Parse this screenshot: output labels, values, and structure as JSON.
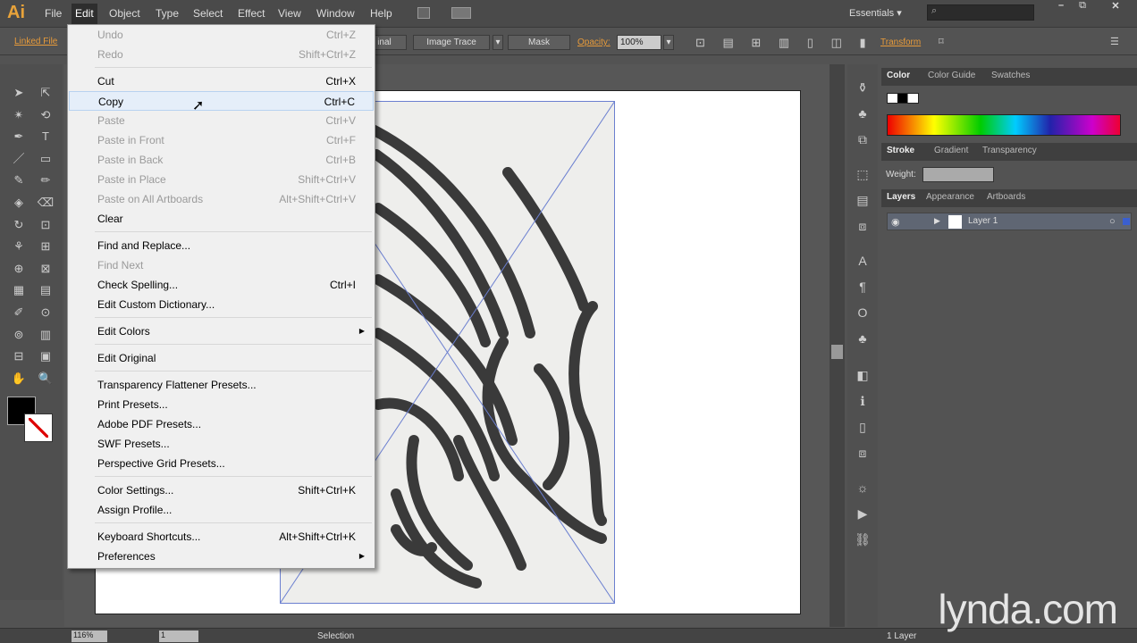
{
  "app": {
    "logo": "Ai"
  },
  "menubar": [
    "File",
    "Edit",
    "Object",
    "Type",
    "Select",
    "Effect",
    "View",
    "Window",
    "Help"
  ],
  "workspace": "Essentials",
  "control": {
    "linked_file": "Linked File",
    "embed_partial": "inal",
    "image_trace": "Image Trace",
    "mask": "Mask",
    "opacity_label": "Opacity:",
    "opacity_value": "100%",
    "transform": "Transform"
  },
  "edit_menu": [
    {
      "label": "Undo",
      "shortcut": "Ctrl+Z",
      "disabled": true
    },
    {
      "label": "Redo",
      "shortcut": "Shift+Ctrl+Z",
      "disabled": true
    },
    {
      "sep": true
    },
    {
      "label": "Cut",
      "shortcut": "Ctrl+X"
    },
    {
      "label": "Copy",
      "shortcut": "Ctrl+C",
      "highlight": true
    },
    {
      "label": "Paste",
      "shortcut": "Ctrl+V",
      "disabled": true
    },
    {
      "label": "Paste in Front",
      "shortcut": "Ctrl+F",
      "disabled": true
    },
    {
      "label": "Paste in Back",
      "shortcut": "Ctrl+B",
      "disabled": true
    },
    {
      "label": "Paste in Place",
      "shortcut": "Shift+Ctrl+V",
      "disabled": true
    },
    {
      "label": "Paste on All Artboards",
      "shortcut": "Alt+Shift+Ctrl+V",
      "disabled": true
    },
    {
      "label": "Clear",
      "shortcut": ""
    },
    {
      "sep": true
    },
    {
      "label": "Find and Replace...",
      "shortcut": ""
    },
    {
      "label": "Find Next",
      "shortcut": "",
      "disabled": true
    },
    {
      "label": "Check Spelling...",
      "shortcut": "Ctrl+I"
    },
    {
      "label": "Edit Custom Dictionary...",
      "shortcut": ""
    },
    {
      "sep": true
    },
    {
      "label": "Edit Colors",
      "shortcut": "",
      "submenu": true
    },
    {
      "sep": true
    },
    {
      "label": "Edit Original",
      "shortcut": ""
    },
    {
      "sep": true
    },
    {
      "label": "Transparency Flattener Presets...",
      "shortcut": ""
    },
    {
      "label": "Print Presets...",
      "shortcut": ""
    },
    {
      "label": "Adobe PDF Presets...",
      "shortcut": ""
    },
    {
      "label": "SWF Presets...",
      "shortcut": ""
    },
    {
      "label": "Perspective Grid Presets...",
      "shortcut": ""
    },
    {
      "sep": true
    },
    {
      "label": "Color Settings...",
      "shortcut": "Shift+Ctrl+K"
    },
    {
      "label": "Assign Profile...",
      "shortcut": ""
    },
    {
      "sep": true
    },
    {
      "label": "Keyboard Shortcuts...",
      "shortcut": "Alt+Shift+Ctrl+K"
    },
    {
      "label": "Preferences",
      "shortcut": "",
      "submenu": true
    }
  ],
  "panels": {
    "color_tabs": [
      "Color",
      "Color Guide",
      "Swatches"
    ],
    "stroke_tabs": [
      "Stroke",
      "Gradient",
      "Transparency"
    ],
    "weight_label": "Weight:",
    "layers_tabs": [
      "Layers",
      "Appearance",
      "Artboards"
    ],
    "layer_name": "Layer 1",
    "layer_count": "1 Layer"
  },
  "status": {
    "zoom": "116%",
    "artboard": "1",
    "tool": "Selection"
  },
  "watermark": "lynda.com"
}
